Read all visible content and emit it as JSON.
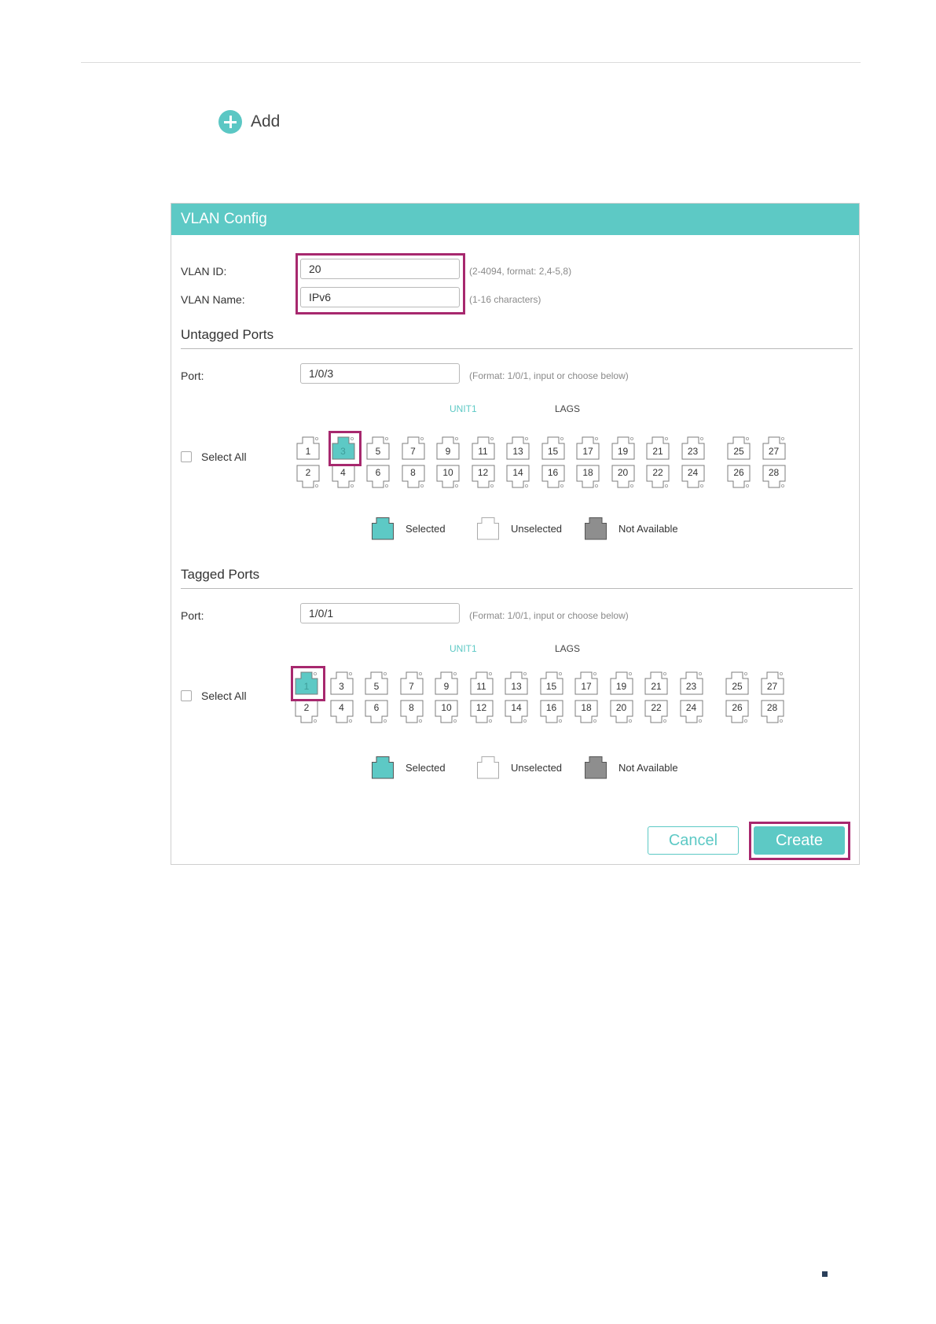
{
  "add_button": {
    "label": "Add"
  },
  "panel": {
    "title": "VLAN Config"
  },
  "vlan_id": {
    "label": "VLAN ID:",
    "value": "20",
    "hint": "(2-4094, format: 2,4-5,8)"
  },
  "vlan_name": {
    "label": "VLAN Name:",
    "value": "IPv6",
    "hint": "(1-16 characters)"
  },
  "untagged": {
    "title": "Untagged Ports",
    "port_label": "Port:",
    "port_value": "1/0/3",
    "port_hint": "(Format: 1/0/1, input or choose below)",
    "unit_label": "UNIT1",
    "lags_label": "LAGS",
    "select_all": "Select All",
    "selected_ports": [
      3
    ]
  },
  "tagged": {
    "title": "Tagged Ports",
    "port_label": "Port:",
    "port_value": "1/0/1",
    "port_hint": "(Format: 1/0/1, input or choose below)",
    "unit_label": "UNIT1",
    "lags_label": "LAGS",
    "select_all": "Select All",
    "selected_ports": [
      1
    ]
  },
  "legend": {
    "selected": "Selected",
    "unselected": "Unselected",
    "not_available": "Not Available"
  },
  "buttons": {
    "cancel": "Cancel",
    "create": "Create"
  },
  "colors": {
    "accent": "#5dc9c5",
    "highlight": "#a7286e",
    "not_available": "#8e8e8e"
  },
  "icons": {
    "add": "plus-circle-icon",
    "port": "ethernet-port-icon"
  }
}
